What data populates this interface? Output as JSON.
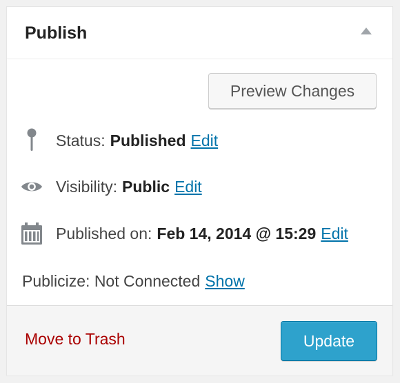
{
  "header": {
    "title": "Publish",
    "toggle_icon": "triangle-up-icon"
  },
  "preview_button": {
    "label": "Preview Changes"
  },
  "status": {
    "icon": "pin-icon",
    "label": "Status:",
    "value": "Published",
    "edit": "Edit"
  },
  "visibility": {
    "icon": "eye-icon",
    "label": "Visibility:",
    "value": "Public",
    "edit": "Edit"
  },
  "published_on": {
    "icon": "calendar-icon",
    "label": "Published on:",
    "value": "Feb 14, 2014 @ 15:29",
    "edit": "Edit"
  },
  "publicize": {
    "label": "Publicize: Not Connected",
    "link": "Show"
  },
  "footer": {
    "trash_label": "Move to Trash",
    "update_label": "Update"
  },
  "colors": {
    "link": "#0073aa",
    "trash": "#aa0000",
    "primary_button": "#2ea2cc",
    "icon": "#82878c"
  }
}
